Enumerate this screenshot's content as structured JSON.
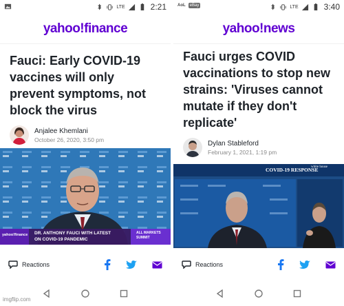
{
  "left": {
    "status": {
      "lte": "LTE",
      "time": "2:21"
    },
    "brand": "yahoo!finance",
    "headline": "Fauci: Early COVID-19 vaccines will only prevent symptoms, not block the virus",
    "author": "Anjalee Khemlani",
    "date": "October 26, 2020, 3:50 pm",
    "video": {
      "lower_third_logo": "yahoo!finance",
      "lower_third_text_1": "DR. ANTHONY FAUCI WITH LATEST",
      "lower_third_text_2": "ON COVID-19 PANDEMIC",
      "badge_1": "ALL MARKETS",
      "badge_2": "SUMMIT"
    },
    "reactions_label": "Reactions"
  },
  "right": {
    "status": {
      "aol": "AoL",
      "mini": "eBay",
      "lte": "LTE",
      "time": "3:40"
    },
    "brand": "yahoo!news",
    "headline": "Fauci urges COVID vaccinations to stop new strains: 'Viruses cannot mutate if they don't replicate'",
    "author": "Dylan Stableford",
    "date": "February 1, 2021, 1:19 pm",
    "video": {
      "banner": "COVID-19 RESPONSE",
      "banner_logo": "white house"
    },
    "reactions_label": "Reactions"
  },
  "watermark": "imgflip.com",
  "colors": {
    "brand_purple": "#6001d2",
    "facebook": "#1877f2",
    "twitter": "#1da1f2",
    "mail": "#6001d2"
  },
  "icons": [
    "image-icon",
    "bluetooth-icon",
    "vibrate-icon",
    "signal-icon",
    "battery-icon",
    "reactions-icon",
    "facebook-icon",
    "twitter-icon",
    "mail-icon",
    "back-icon",
    "home-icon",
    "recents-icon"
  ]
}
